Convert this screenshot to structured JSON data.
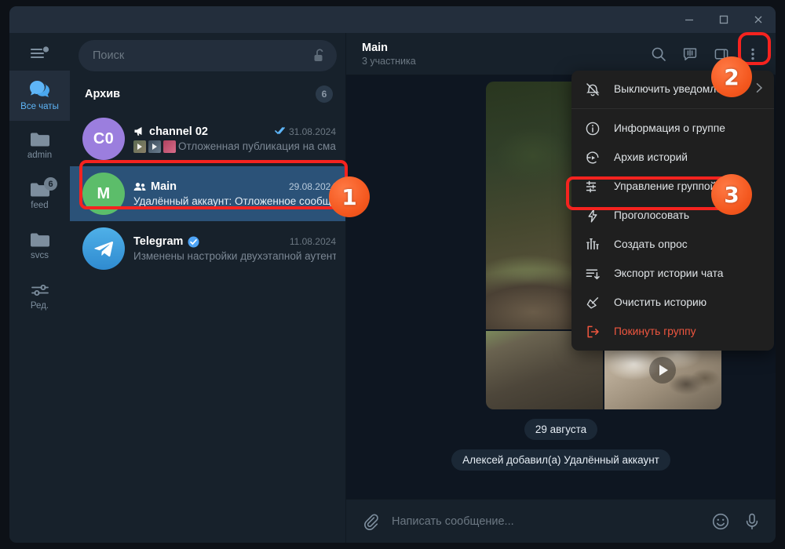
{
  "window": {
    "minimize_label": "Свернуть",
    "maximize_label": "Развернуть",
    "close_label": "Закрыть"
  },
  "rail": {
    "menu_icon": "hamburger-menu-icon",
    "items": [
      {
        "label": "Все чаты",
        "icon": "chats-bubble-icon",
        "active": true,
        "badge": ""
      },
      {
        "label": "admin",
        "icon": "folder-icon",
        "active": false,
        "badge": ""
      },
      {
        "label": "feed",
        "icon": "folder-icon",
        "active": false,
        "badge": "6"
      },
      {
        "label": "svcs",
        "icon": "folder-icon",
        "active": false,
        "badge": ""
      },
      {
        "label": "Ред.",
        "icon": "sliders-icon",
        "active": false,
        "badge": ""
      }
    ]
  },
  "search": {
    "placeholder": "Поиск",
    "lock_icon": "unlocked-padlock-icon"
  },
  "chat_list": {
    "archive": {
      "label": "Архив",
      "count": "6"
    },
    "items": [
      {
        "name": "channel 02",
        "date": "31.08.2024",
        "preview": "Отложенная публикация на смар…",
        "avatar_text": "C0",
        "avatar_color": "#9b7ede",
        "selected": false,
        "verified": false,
        "megaphone": true,
        "group_icon": false,
        "read_ticks": true,
        "thumbs": 3
      },
      {
        "name": "Main",
        "date": "29.08.2024",
        "preview": "Удалённый аккаунт: Отложенное сообщен…",
        "avatar_text": "M",
        "avatar_color": "#5cbd6a",
        "selected": true,
        "verified": false,
        "megaphone": false,
        "group_icon": true,
        "read_ticks": false,
        "thumbs": 0
      },
      {
        "name": "Telegram",
        "date": "11.08.2024",
        "preview": "Изменены настройки двухэтапной аутент…",
        "avatar_text": "",
        "avatar_color": "#3f9ae0",
        "selected": false,
        "verified": true,
        "megaphone": false,
        "group_icon": false,
        "read_ticks": false,
        "thumbs": 0
      }
    ]
  },
  "chat_header": {
    "title": "Main",
    "subtitle": "3 участника",
    "actions": [
      {
        "name": "search-icon",
        "label": "Поиск"
      },
      {
        "name": "stories-icon",
        "label": "Истории"
      },
      {
        "name": "sidebar-toggle-icon",
        "label": "Панель"
      },
      {
        "name": "more-vertical-icon",
        "label": "Ещё"
      }
    ]
  },
  "messages": {
    "media": [
      {
        "kind": "video",
        "name": "deer-video",
        "has_play": true
      },
      {
        "kind": "photo",
        "name": "burned-field-photo",
        "has_play": false
      },
      {
        "kind": "video",
        "name": "explosion-video",
        "has_play": true
      }
    ],
    "date_divider": "29 августа",
    "service_message": "Алексей добавил(а) Удалённый аккаунт"
  },
  "composer": {
    "attach_icon": "paperclip-icon",
    "placeholder": "Написать сообщение...",
    "emoji_icon": "smiley-icon",
    "mic_icon": "microphone-icon"
  },
  "context_menu": {
    "items": [
      {
        "label": "Выключить уведомления",
        "icon": "mute-bell-icon",
        "danger": false,
        "submenu": true,
        "separator_after": true
      },
      {
        "label": "Информация о группе",
        "icon": "info-circle-icon",
        "danger": false,
        "submenu": false,
        "separator_after": false
      },
      {
        "label": "Архив историй",
        "icon": "stories-archive-icon",
        "danger": false,
        "submenu": false,
        "separator_after": false
      },
      {
        "label": "Управление группой",
        "icon": "sliders-icon",
        "danger": false,
        "submenu": false,
        "separator_after": false
      },
      {
        "label": "Проголосовать",
        "icon": "boost-lightning-icon",
        "danger": false,
        "submenu": false,
        "separator_after": false
      },
      {
        "label": "Создать опрос",
        "icon": "poll-bars-icon",
        "danger": false,
        "submenu": false,
        "separator_after": false
      },
      {
        "label": "Экспорт истории чата",
        "icon": "export-down-icon",
        "danger": false,
        "submenu": false,
        "separator_after": false
      },
      {
        "label": "Очистить историю",
        "icon": "broom-icon",
        "danger": false,
        "submenu": false,
        "separator_after": false
      },
      {
        "label": "Покинуть группу",
        "icon": "leave-arrow-icon",
        "danger": true,
        "submenu": false,
        "separator_after": false
      }
    ]
  },
  "annotations": {
    "steps": [
      {
        "number": "1",
        "target": "chat-list-item-main"
      },
      {
        "number": "2",
        "target": "chat-header-more-button"
      },
      {
        "number": "3",
        "target": "menu-item-manage-group"
      }
    ],
    "highlight_color": "#f5231f",
    "badge_color": "#f4581f"
  }
}
